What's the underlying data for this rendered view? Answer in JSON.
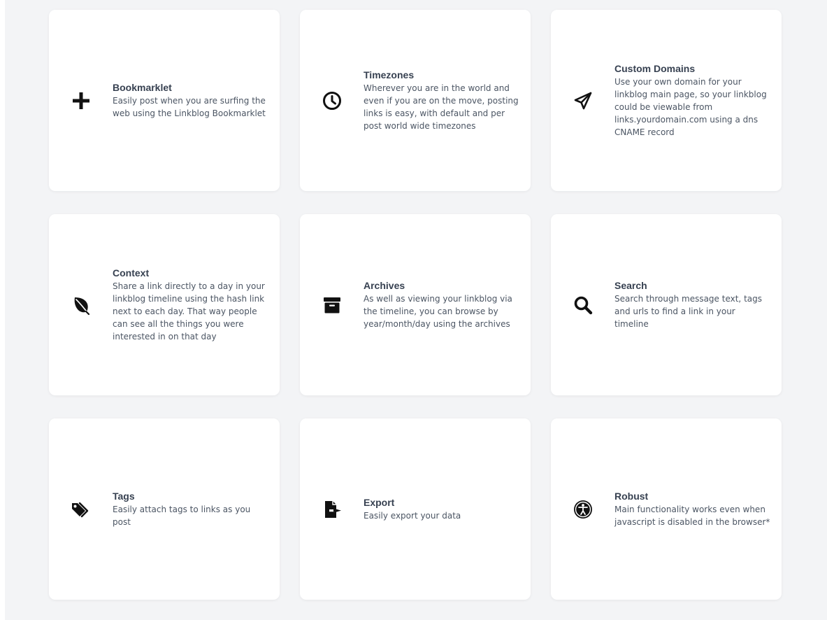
{
  "features": [
    {
      "title": "Bookmarklet",
      "description": "Easily post when you are surfing the web using the Linkblog Bookmarklet",
      "icon": "plus-icon"
    },
    {
      "title": "Timezones",
      "description": "Wherever you are in the world and even if you are on the move, posting links is easy, with default and per post world wide timezones",
      "icon": "clock-icon"
    },
    {
      "title": "Custom Domains",
      "description": "Use your own domain for your linkblog main page, so your linkblog could be viewable from links.yourdomain.com using a dns CNAME record",
      "icon": "paper-plane-icon"
    },
    {
      "title": "Context",
      "description": "Share a link directly to a day in your linkblog timeline using the hash link next to each day. That way people can see all the things you were interested in on that day",
      "icon": "leaf-icon"
    },
    {
      "title": "Archives",
      "description": "As well as viewing your linkblog via the timeline, you can browse by year/month/day using the archives",
      "icon": "archive-box-icon"
    },
    {
      "title": "Search",
      "description": "Search through message text, tags and urls to find a link in your timeline",
      "icon": "search-icon"
    },
    {
      "title": "Tags",
      "description": "Easily attach tags to links as you post",
      "icon": "tags-icon"
    },
    {
      "title": "Export",
      "description": "Easily export your data",
      "icon": "file-export-icon"
    },
    {
      "title": "Robust",
      "description": "Main functionality works even when javascript is disabled in the browser*",
      "icon": "universal-access-icon"
    }
  ]
}
